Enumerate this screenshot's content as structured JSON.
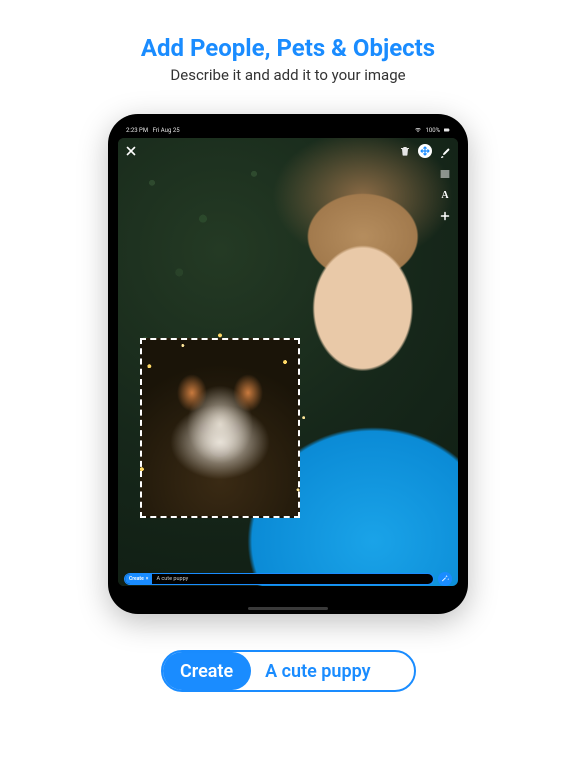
{
  "hero": {
    "title": "Add People, Pets & Objects",
    "subtitle": "Describe it and add it to your image"
  },
  "status": {
    "time": "2:23 PM",
    "date": "Fri Aug 25",
    "battery": "100%"
  },
  "toolbar": {
    "close": "close",
    "trash": "trash",
    "move": "move",
    "brush": "brush",
    "layers": "layers",
    "text_tool": "A",
    "add": "+"
  },
  "prompt": {
    "chip": "Create",
    "value": "A cute puppy"
  },
  "cta": {
    "chip": "Create",
    "text": "A cute puppy"
  }
}
